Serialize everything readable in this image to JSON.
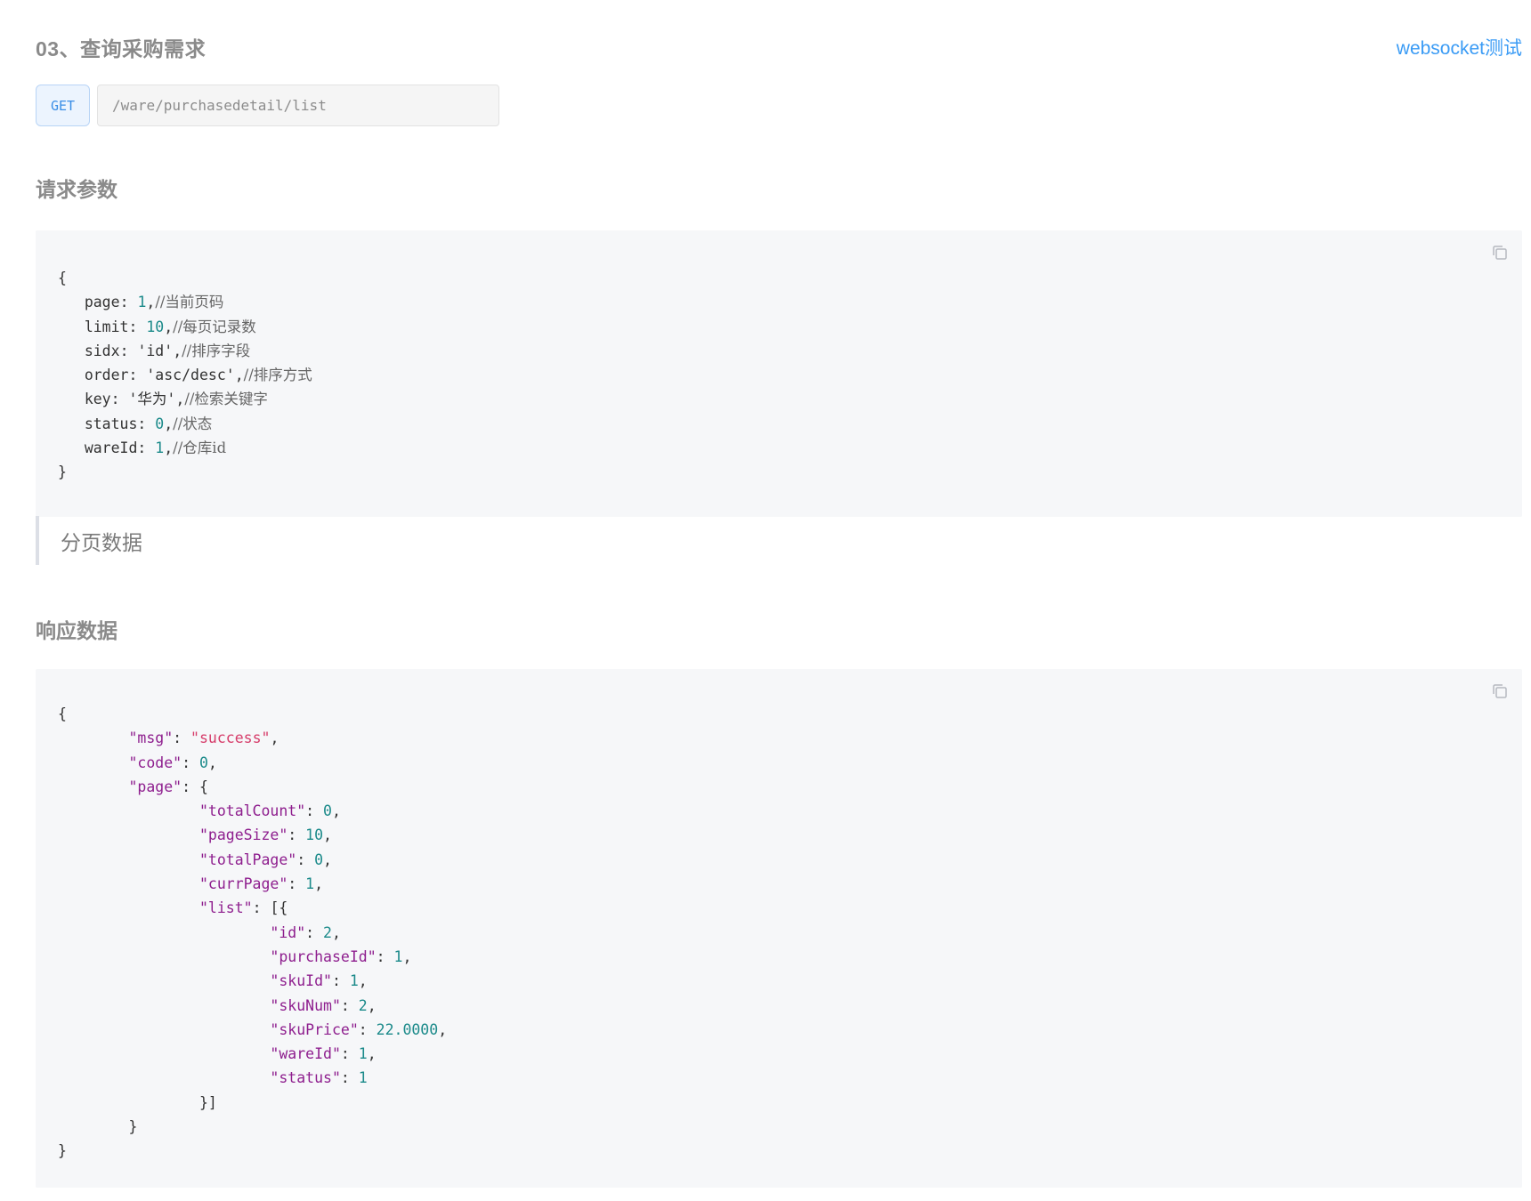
{
  "header": {
    "title": "03、查询采购需求",
    "ws_link": "websocket测试"
  },
  "request": {
    "method": "GET",
    "url": "/ware/purchasedetail/list"
  },
  "params_section": {
    "heading": "请求参数",
    "lines": [
      {
        "text": "{"
      },
      {
        "indent": "   ",
        "key": "page",
        "value": "1",
        "vtype": "num",
        "comment": "//当前页码"
      },
      {
        "indent": "   ",
        "key": "limit",
        "value": "10",
        "vtype": "num",
        "comment": "//每页记录数"
      },
      {
        "indent": "   ",
        "key": "sidx",
        "value": "'id'",
        "vtype": "plain",
        "comment": "//排序字段"
      },
      {
        "indent": "   ",
        "key": "order",
        "value": "'asc/desc'",
        "vtype": "plain",
        "comment": "//排序方式"
      },
      {
        "indent": "   ",
        "key": "key",
        "value": "'华为'",
        "vtype": "plain",
        "comment": "//检索关键字"
      },
      {
        "indent": "   ",
        "key": "status",
        "value": "0",
        "vtype": "num",
        "comment": "//状态"
      },
      {
        "indent": "   ",
        "key": "wareId",
        "value": "1",
        "vtype": "num",
        "comment": "//仓库id"
      },
      {
        "text": "}"
      }
    ]
  },
  "note": {
    "text": "分页数据"
  },
  "response_section": {
    "heading": "响应数据",
    "lines": [
      {
        "text": "{"
      },
      {
        "indent": "\t",
        "key": "\"msg\"",
        "value": "\"success\"",
        "vtype": "str",
        "tail": ","
      },
      {
        "indent": "\t",
        "key": "\"code\"",
        "value": "0",
        "vtype": "num",
        "tail": ","
      },
      {
        "indent": "\t",
        "key": "\"page\"",
        "value": "{",
        "vtype": "plain",
        "tail": ""
      },
      {
        "indent": "\t\t",
        "key": "\"totalCount\"",
        "value": "0",
        "vtype": "num",
        "tail": ","
      },
      {
        "indent": "\t\t",
        "key": "\"pageSize\"",
        "value": "10",
        "vtype": "num",
        "tail": ","
      },
      {
        "indent": "\t\t",
        "key": "\"totalPage\"",
        "value": "0",
        "vtype": "num",
        "tail": ","
      },
      {
        "indent": "\t\t",
        "key": "\"currPage\"",
        "value": "1",
        "vtype": "num",
        "tail": ","
      },
      {
        "indent": "\t\t",
        "key": "\"list\"",
        "value": "[{",
        "vtype": "plain",
        "tail": ""
      },
      {
        "indent": "\t\t\t",
        "key": "\"id\"",
        "value": "2",
        "vtype": "num",
        "tail": ","
      },
      {
        "indent": "\t\t\t",
        "key": "\"purchaseId\"",
        "value": "1",
        "vtype": "num",
        "tail": ","
      },
      {
        "indent": "\t\t\t",
        "key": "\"skuId\"",
        "value": "1",
        "vtype": "num",
        "tail": ","
      },
      {
        "indent": "\t\t\t",
        "key": "\"skuNum\"",
        "value": "2",
        "vtype": "num",
        "tail": ","
      },
      {
        "indent": "\t\t\t",
        "key": "\"skuPrice\"",
        "value": "22.0000",
        "vtype": "num",
        "tail": ","
      },
      {
        "indent": "\t\t\t",
        "key": "\"wareId\"",
        "value": "1",
        "vtype": "num",
        "tail": ","
      },
      {
        "indent": "\t\t\t",
        "key": "\"status\"",
        "value": "1",
        "vtype": "num",
        "tail": ""
      },
      {
        "indent": "\t\t",
        "text": "}]"
      },
      {
        "indent": "\t",
        "text": "}"
      },
      {
        "text": "}"
      }
    ]
  },
  "icons": {
    "copy": "copy-icon"
  },
  "colors": {
    "link": "#3a9bf5",
    "method_badge": "#3a8ee6",
    "code_bg": "#f6f7f9",
    "number": "#1b8a8a",
    "string": "#d63c6a",
    "json_key": "#8e1e8e"
  }
}
